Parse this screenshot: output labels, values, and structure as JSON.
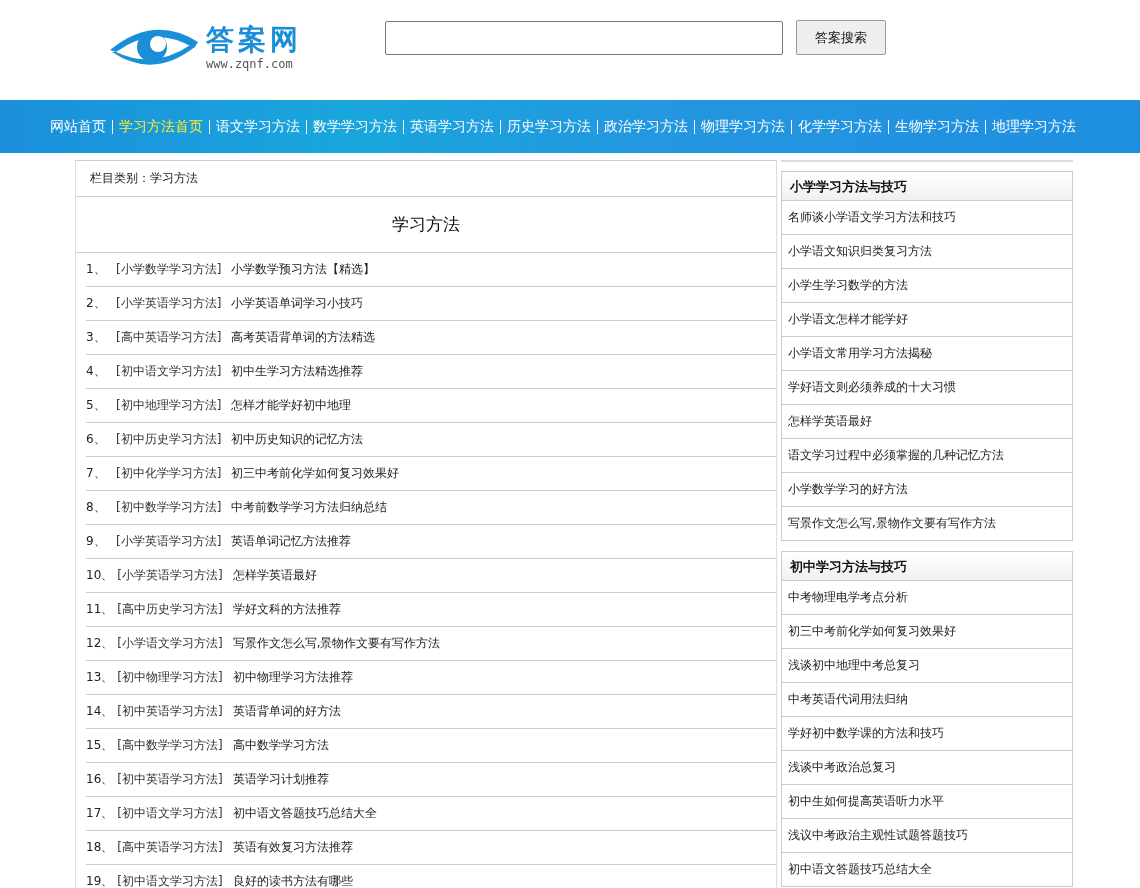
{
  "logo": {
    "name": "答案网",
    "url": "www.zqnf.com"
  },
  "search": {
    "button": "答案搜索"
  },
  "nav": [
    {
      "label": "网站首页",
      "selected": false
    },
    {
      "label": "学习方法首页",
      "selected": true
    },
    {
      "label": "语文学习方法",
      "selected": false
    },
    {
      "label": "数学学习方法",
      "selected": false
    },
    {
      "label": "英语学习方法",
      "selected": false
    },
    {
      "label": "历史学习方法",
      "selected": false
    },
    {
      "label": "政治学习方法",
      "selected": false
    },
    {
      "label": "物理学习方法",
      "selected": false
    },
    {
      "label": "化学学习方法",
      "selected": false
    },
    {
      "label": "生物学习方法",
      "selected": false
    },
    {
      "label": "地理学习方法",
      "selected": false
    }
  ],
  "breadcrumb": "栏目类别：学习方法",
  "list_title": "学习方法",
  "articles": [
    {
      "number": "1、",
      "category": "[小学数学学习方法]",
      "title": "小学数学预习方法【精选】"
    },
    {
      "number": "2、",
      "category": "[小学英语学习方法]",
      "title": "小学英语单词学习小技巧"
    },
    {
      "number": "3、",
      "category": "[高中英语学习方法]",
      "title": "高考英语背单词的方法精选"
    },
    {
      "number": "4、",
      "category": "[初中语文学习方法]",
      "title": "初中生学习方法精选推荐"
    },
    {
      "number": "5、",
      "category": "[初中地理学习方法]",
      "title": "怎样才能学好初中地理"
    },
    {
      "number": "6、",
      "category": "[初中历史学习方法]",
      "title": "初中历史知识的记忆方法"
    },
    {
      "number": "7、",
      "category": "[初中化学学习方法]",
      "title": "初三中考前化学如何复习效果好"
    },
    {
      "number": "8、",
      "category": "[初中数学学习方法]",
      "title": "中考前数学学习方法归纳总结"
    },
    {
      "number": "9、",
      "category": "[小学英语学习方法]",
      "title": "英语单词记忆方法推荐"
    },
    {
      "number": "10、",
      "category": "[小学英语学习方法]",
      "title": "怎样学英语最好"
    },
    {
      "number": "11、",
      "category": "[高中历史学习方法]",
      "title": "学好文科的方法推荐"
    },
    {
      "number": "12、",
      "category": "[小学语文学习方法]",
      "title": "写景作文怎么写,景物作文要有写作方法"
    },
    {
      "number": "13、",
      "category": "[初中物理学习方法]",
      "title": "初中物理学习方法推荐"
    },
    {
      "number": "14、",
      "category": "[初中英语学习方法]",
      "title": "英语背单词的好方法"
    },
    {
      "number": "15、",
      "category": "[高中数学学习方法]",
      "title": "高中数学学习方法"
    },
    {
      "number": "16、",
      "category": "[初中英语学习方法]",
      "title": "英语学习计划推荐"
    },
    {
      "number": "17、",
      "category": "[初中语文学习方法]",
      "title": "初中语文答题技巧总结大全"
    },
    {
      "number": "18、",
      "category": "[高中英语学习方法]",
      "title": "英语有效复习方法推荐"
    },
    {
      "number": "19、",
      "category": "[初中语文学习方法]",
      "title": "良好的读书方法有哪些"
    }
  ],
  "sidebar": [
    {
      "title": "小学学习方法与技巧",
      "items": [
        "名师谈小学语文学习方法和技巧",
        "小学语文知识归类复习方法",
        "小学生学习数学的方法",
        "小学语文怎样才能学好",
        "小学语文常用学习方法揭秘",
        "学好语文则必须养成的十大习惯",
        "怎样学英语最好",
        "语文学习过程中必须掌握的几种记忆方法",
        "小学数学学习的好方法",
        "写景作文怎么写,景物作文要有写作方法"
      ]
    },
    {
      "title": "初中学习方法与技巧",
      "items": [
        "中考物理电学考点分析",
        "初三中考前化学如何复习效果好",
        "浅谈初中地理中考总复习",
        "中考英语代词用法归纳",
        "学好初中数学课的方法和技巧",
        "浅谈中考政治总复习",
        "初中生如何提高英语听力水平",
        "浅议中考政治主观性试题答题技巧",
        "初中语文答题技巧总结大全"
      ]
    }
  ]
}
